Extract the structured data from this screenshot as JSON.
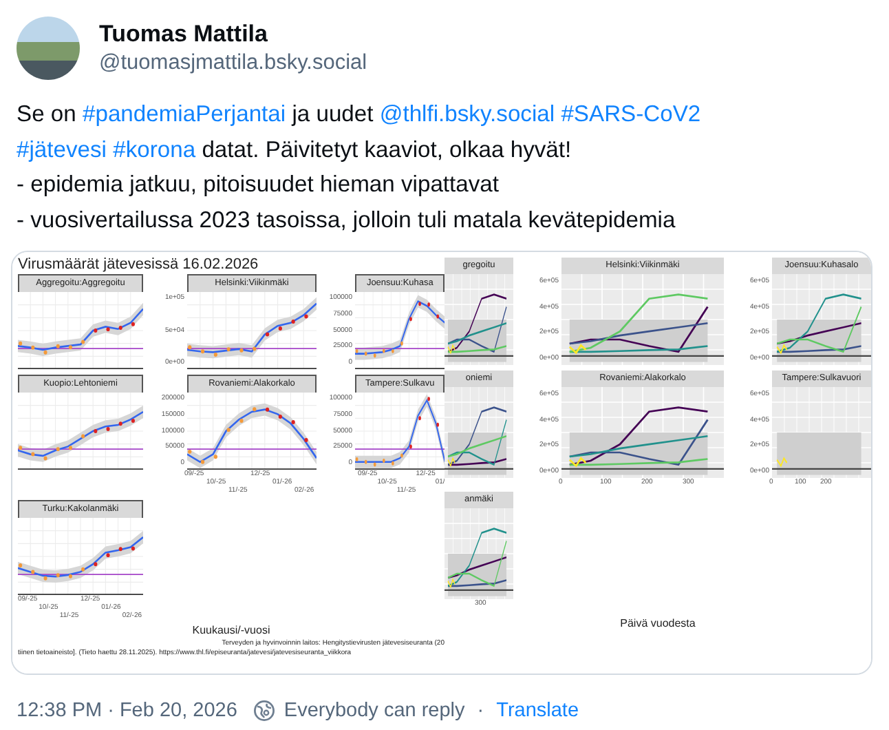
{
  "author": {
    "name": "Tuomas Mattila",
    "handle": "@tuomasjmattila.bsky.social"
  },
  "post_text": [
    [
      {
        "kind": "text",
        "text": "Se on "
      },
      {
        "kind": "hashtag",
        "text": "#pandemiaPerjantai"
      },
      {
        "kind": "text",
        "text": " ja uudet "
      },
      {
        "kind": "mention",
        "text": "@thlfi.bsky.social"
      },
      {
        "kind": "hashtag",
        "text": "#SARS-CoV2"
      }
    ],
    [
      {
        "kind": "hashtag",
        "text": "#jätevesi"
      },
      {
        "kind": "hashtag",
        "text": "#korona"
      },
      {
        "kind": "text",
        "text": " datat. Päivitetyt kaaviot, olkaa hyvät!"
      }
    ],
    [
      {
        "kind": "text",
        "text": "- epidemia jatkuu, pitoisuudet hieman vipattavat"
      }
    ],
    [
      {
        "kind": "text",
        "text": "- vuosivertailussa 2023 tasoissa, jolloin tuli matala kevätepidemia"
      }
    ]
  ],
  "images": [
    {
      "kind": "timeseries",
      "title": "Virusmäärät jätevesissä 16.02.2026",
      "panels": [
        {
          "title": "Aggregoitu:Aggregoitu"
        },
        {
          "title": "Helsinki:Viikinmäki",
          "yticks": [
            "1e+05",
            "5e+04",
            "0e+00"
          ]
        },
        {
          "title": "Joensuu:Kuhasa",
          "yticks": [
            "100000",
            "75000",
            "50000",
            "25000",
            "0"
          ]
        },
        {
          "title": "Kuopio:Lehtoniemi"
        },
        {
          "title": "Rovaniemi:Alakorkalo",
          "yticks": [
            "200000",
            "150000",
            "100000",
            "50000",
            "0"
          ],
          "xticks": [
            "09/-25",
            "10/-25",
            "11/-25",
            "12/-25",
            "01/-26",
            "02/-26"
          ]
        },
        {
          "title": "Tampere:Sulkavu",
          "yticks": [
            "100000",
            "75000",
            "50000",
            "25000",
            "0"
          ],
          "xticks": [
            "09/-25",
            "10/-25",
            "11/-25",
            "12/-25",
            "01/"
          ]
        },
        {
          "title": "Turku:Kakolanmäki",
          "xticks": [
            "09/-25",
            "10/-25",
            "11/-25",
            "12/-25",
            "01/-26",
            "02/-26"
          ]
        }
      ],
      "xlabel": "Kuukausi/-vuosi",
      "source": [
        "Terveyden ja hyvinvoinnin laitos: Hengitystievirusten jätevesiseuranta (20",
        "tiinen tietoaineisto]. (Tieto haettu 28.11.2025). https://www.thl.fi/episeuranta/jatevesi/jatevesiseuranta_viikkora"
      ]
    },
    {
      "kind": "yearly",
      "panels": [
        {
          "title": "gregoitu"
        },
        {
          "title": "Helsinki:Viikinmäki",
          "yticks": [
            "6e+05",
            "4e+05",
            "2e+05",
            "0e+00"
          ]
        },
        {
          "title": "Joensuu:Kuhasalo",
          "yticks": [
            "6e+05",
            "4e+05",
            "2e+05",
            "0e+00"
          ]
        },
        {
          "title": "oniemi"
        },
        {
          "title": "Rovaniemi:Alakorkalo",
          "yticks": [
            "6e+05",
            "4e+05",
            "2e+05",
            "0e+00"
          ],
          "xticks": [
            "0",
            "100",
            "200",
            "300"
          ]
        },
        {
          "title": "Tampere:Sulkavuori",
          "yticks": [
            "6e+05",
            "4e+05",
            "2e+05",
            "0e+00"
          ],
          "xticks": [
            "0",
            "100",
            "200"
          ]
        },
        {
          "title": "anmäki",
          "xticks": [
            "300"
          ]
        }
      ],
      "xlabel": "Päivä vuodesta"
    }
  ],
  "footer": {
    "timestamp": "12:38 PM · Feb 20, 2026",
    "reply_setting": "Everybody can reply",
    "separator": "·",
    "translate": "Translate"
  }
}
